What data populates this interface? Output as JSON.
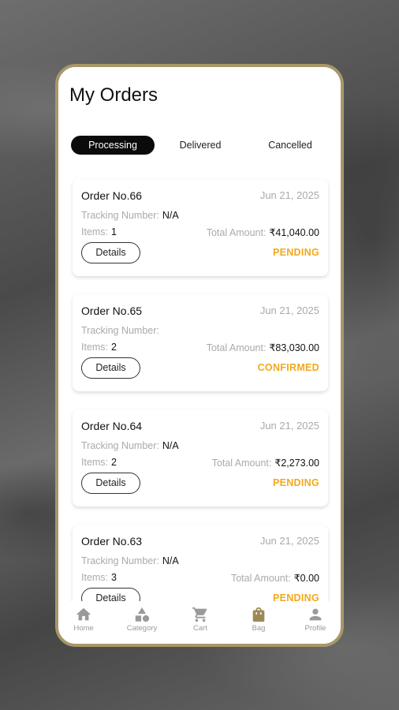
{
  "header": {
    "title": "My Orders"
  },
  "tabs": [
    {
      "label": "Processing",
      "active": true
    },
    {
      "label": "Delivered",
      "active": false
    },
    {
      "label": "Cancelled",
      "active": false
    }
  ],
  "labels": {
    "tracking": "Tracking Number:",
    "items": "Items:",
    "total": "Total Amount:",
    "details": "Details"
  },
  "orders": [
    {
      "order_no": "Order No.66",
      "date": "Jun 21, 2025",
      "tracking": "N/A",
      "items": "1",
      "total": "₹41,040.00",
      "status": "PENDING"
    },
    {
      "order_no": "Order No.65",
      "date": "Jun 21, 2025",
      "tracking": "",
      "items": "2",
      "total": "₹83,030.00",
      "status": "CONFIRMED"
    },
    {
      "order_no": "Order No.64",
      "date": "Jun 21, 2025",
      "tracking": "N/A",
      "items": "2",
      "total": "₹2,273.00",
      "status": "PENDING"
    },
    {
      "order_no": "Order No.63",
      "date": "Jun 21, 2025",
      "tracking": "N/A",
      "items": "3",
      "total": "₹0.00",
      "status": "PENDING"
    }
  ],
  "nav": [
    {
      "label": "Home",
      "icon": "home-icon"
    },
    {
      "label": "Category",
      "icon": "category-icon"
    },
    {
      "label": "Cart",
      "icon": "cart-icon"
    },
    {
      "label": "Bag",
      "icon": "bag-icon"
    },
    {
      "label": "Profile",
      "icon": "profile-icon"
    }
  ],
  "colors": {
    "accent_status": "#f3a81c",
    "frame": "#a89868",
    "active_nav_icon": "#9c8a56",
    "inactive_nav_icon": "#9a9a9a"
  }
}
